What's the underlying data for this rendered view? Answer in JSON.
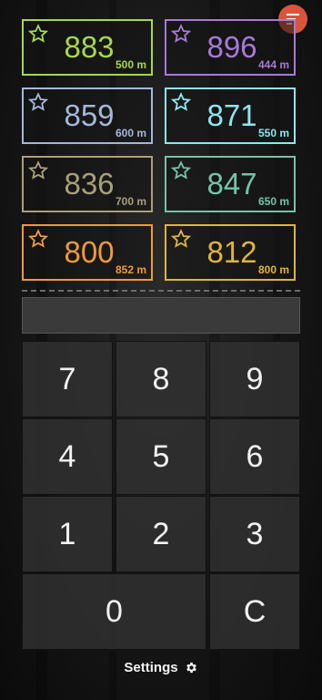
{
  "tiles": [
    {
      "value": "883",
      "distance": "500 m",
      "color": "#a6d84a"
    },
    {
      "value": "896",
      "distance": "444 m",
      "color": "#a879d8"
    },
    {
      "value": "859",
      "distance": "600 m",
      "color": "#a4b8d8"
    },
    {
      "value": "871",
      "distance": "550 m",
      "color": "#8fe6ee"
    },
    {
      "value": "836",
      "distance": "700 m",
      "color": "#a8a07a"
    },
    {
      "value": "847",
      "distance": "650 m",
      "color": "#76c2aa"
    },
    {
      "value": "800",
      "distance": "852 m",
      "color": "#f09a3a"
    },
    {
      "value": "812",
      "distance": "800 m",
      "color": "#e0b43c"
    }
  ],
  "display_value": "",
  "keypad": [
    "7",
    "8",
    "9",
    "4",
    "5",
    "6",
    "1",
    "2",
    "3",
    "0",
    "C"
  ],
  "settings_label": "Settings",
  "icons": {
    "menu": "sort-menu-icon",
    "star": "star-outline-icon",
    "settings": "gear-icon"
  },
  "accent_color": "#d8553b"
}
